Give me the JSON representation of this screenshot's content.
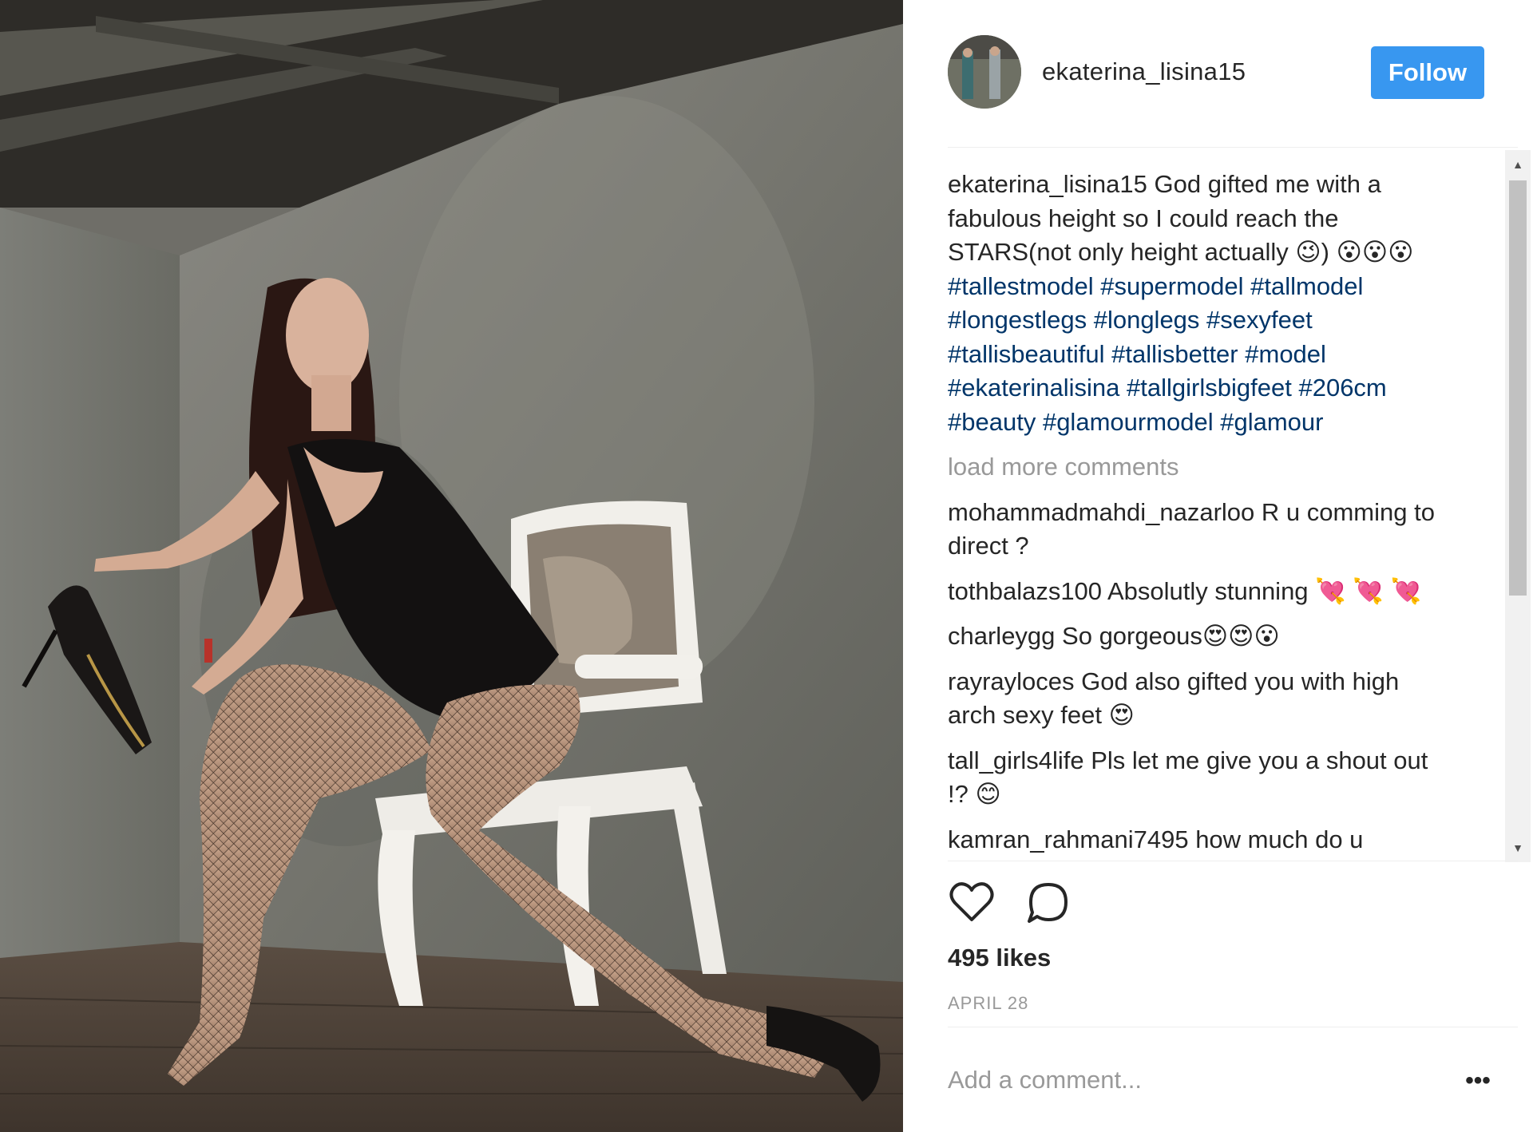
{
  "post": {
    "username": "ekaterina_lisina15",
    "follow_label": "Follow",
    "likes": "495 likes",
    "date": "APRIL 28",
    "add_comment_placeholder": "Add a comment..."
  },
  "caption": {
    "user": "ekaterina_lisina15",
    "text": " God gifted me with a fabulous height so I could reach the STARS(not only height actually 😉) 😮😮😮 ",
    "hashtags": [
      "#tallestmodel",
      "#supermodel",
      "#tallmodel",
      "#longestlegs",
      "#longlegs",
      "#sexyfeet",
      "#tallisbeautiful",
      "#tallisbetter",
      "#model",
      "#ekaterinalisina",
      "#tallgirlsbigfeet",
      "#206cm",
      "#beauty",
      "#glamourmodel",
      "#glamour"
    ]
  },
  "load_more": "load more comments",
  "comments": [
    {
      "user": "mohammadmahdi_nazarloo",
      "text": " R u comming to direct ?"
    },
    {
      "user": "tothbalazs100",
      "text": " Absolutly stunning 💘 💘 💘"
    },
    {
      "user": "charleygg",
      "text": " So gorgeous😍😍😮"
    },
    {
      "user": "rayrayloces",
      "text": " God also gifted you with high arch sexy feet 😍"
    },
    {
      "user": "tall_girls4life",
      "text": " Pls let me give you a shout out !? 😊"
    },
    {
      "user": "kamran_rahmani7495",
      "text": " how much do u"
    }
  ],
  "icons": {
    "like": "heart-icon",
    "comment": "comment-bubble-icon",
    "more": "more-options-icon"
  },
  "colors": {
    "follow_button": "#3897f0",
    "hashtag": "#003569",
    "muted": "#999999"
  }
}
